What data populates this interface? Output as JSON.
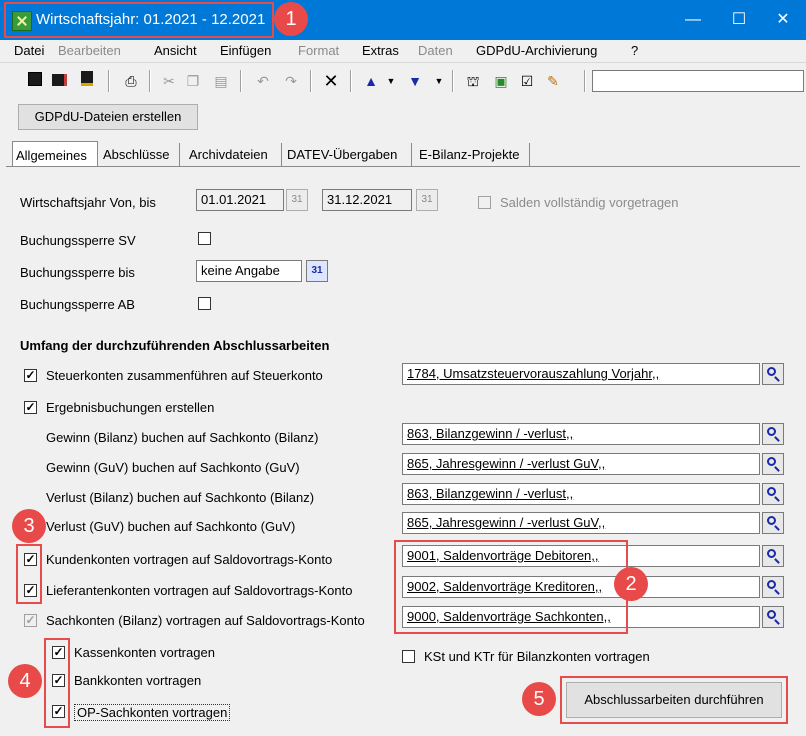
{
  "window": {
    "title": "Wirtschaftsjahr: 01.2021 - 12.2021",
    "minimize": "—",
    "maximize": "☐",
    "close": "✕",
    "accent": "#0078d7"
  },
  "menu": [
    "Datei",
    "Bearbeiten",
    "Ansicht",
    "Einfügen",
    "Format",
    "Extras",
    "Daten",
    "GDPdU-Archivierung",
    "?"
  ],
  "toolbar": {
    "icons": [
      "save-icon",
      "save-all-icon",
      "save-close-icon",
      "print-icon",
      "cut-icon",
      "copy-icon",
      "paste-icon",
      "undo-icon",
      "redo-icon",
      "delete-icon",
      "up-icon",
      "down-icon",
      "tool-a-icon",
      "tool-b-icon",
      "tool-c-icon",
      "tool-d-icon"
    ],
    "gdpdu_button": "GDPdU-Dateien erstellen"
  },
  "tabs": [
    "Allgemeines",
    "Abschlüsse",
    "Archivdateien",
    "DATEV-Übergaben",
    "E-Bilanz-Projekte"
  ],
  "form": {
    "wj_label": "Wirtschaftsjahr Von, bis",
    "wj_from": "01.01.2021",
    "wj_to": "31.12.2021",
    "cal_label": "31",
    "salden_label": "Salden vollständig vorgetragen",
    "sperre_sv_label": "Buchungssperre SV",
    "sperre_bis_label": "Buchungssperre bis",
    "sperre_bis_value": "keine Angabe",
    "sperre_ab_label": "Buchungssperre AB",
    "section_title": "Umfang der durchzuführenden Abschlussarbeiten",
    "steuer_label": "Steuerkonten zusammenführen auf Steuerkonto",
    "steuer_value": "1784, Umsatzsteuervorauszahlung Vorjahr,,",
    "ergebnis_label": "Ergebnisbuchungen erstellen",
    "gewinn_bilanz_label": "Gewinn (Bilanz) buchen auf Sachkonto (Bilanz)",
    "gewinn_bilanz_value": "863, Bilanzgewinn / -verlust,,",
    "gewinn_guv_label": "Gewinn (GuV) buchen auf Sachkonto (GuV)",
    "gewinn_guv_value": "865, Jahresgewinn / -verlust GuV,,",
    "verlust_bilanz_label": "Verlust (Bilanz) buchen auf Sachkonto (Bilanz)",
    "verlust_bilanz_value": "863, Bilanzgewinn / -verlust,,",
    "verlust_guv_label": "Verlust (GuV) buchen auf Sachkonto (GuV)",
    "verlust_guv_value": "865, Jahresgewinn / -verlust GuV,,",
    "kunden_label": "Kundenkonten vortragen auf Saldovortrags-Konto",
    "kunden_value": "9001, Saldenvorträge Debitoren,,",
    "lieferanten_label": "Lieferantenkonten vortragen auf Saldovortrags-Konto",
    "lieferanten_value": "9002, Saldenvorträge Kreditoren,,",
    "sach_label": "Sachkonten (Bilanz) vortragen auf Saldovortrags-Konto",
    "sach_value": "9000, Saldenvorträge Sachkonten,,",
    "kasse_label": "Kassenkonten vortragen",
    "bank_label": "Bankkonten vortragen",
    "op_label": "OP-Sachkonten vortragen",
    "kst_label": "KSt und KTr für Bilanzkonten vortragen",
    "run_button": "Abschlussarbeiten durchführen",
    "check_mark": "✓"
  },
  "annotations": [
    "1",
    "2",
    "3",
    "4",
    "5"
  ],
  "colors": {
    "annotation": "#e84a4a",
    "titlebar": "#0078d7"
  }
}
